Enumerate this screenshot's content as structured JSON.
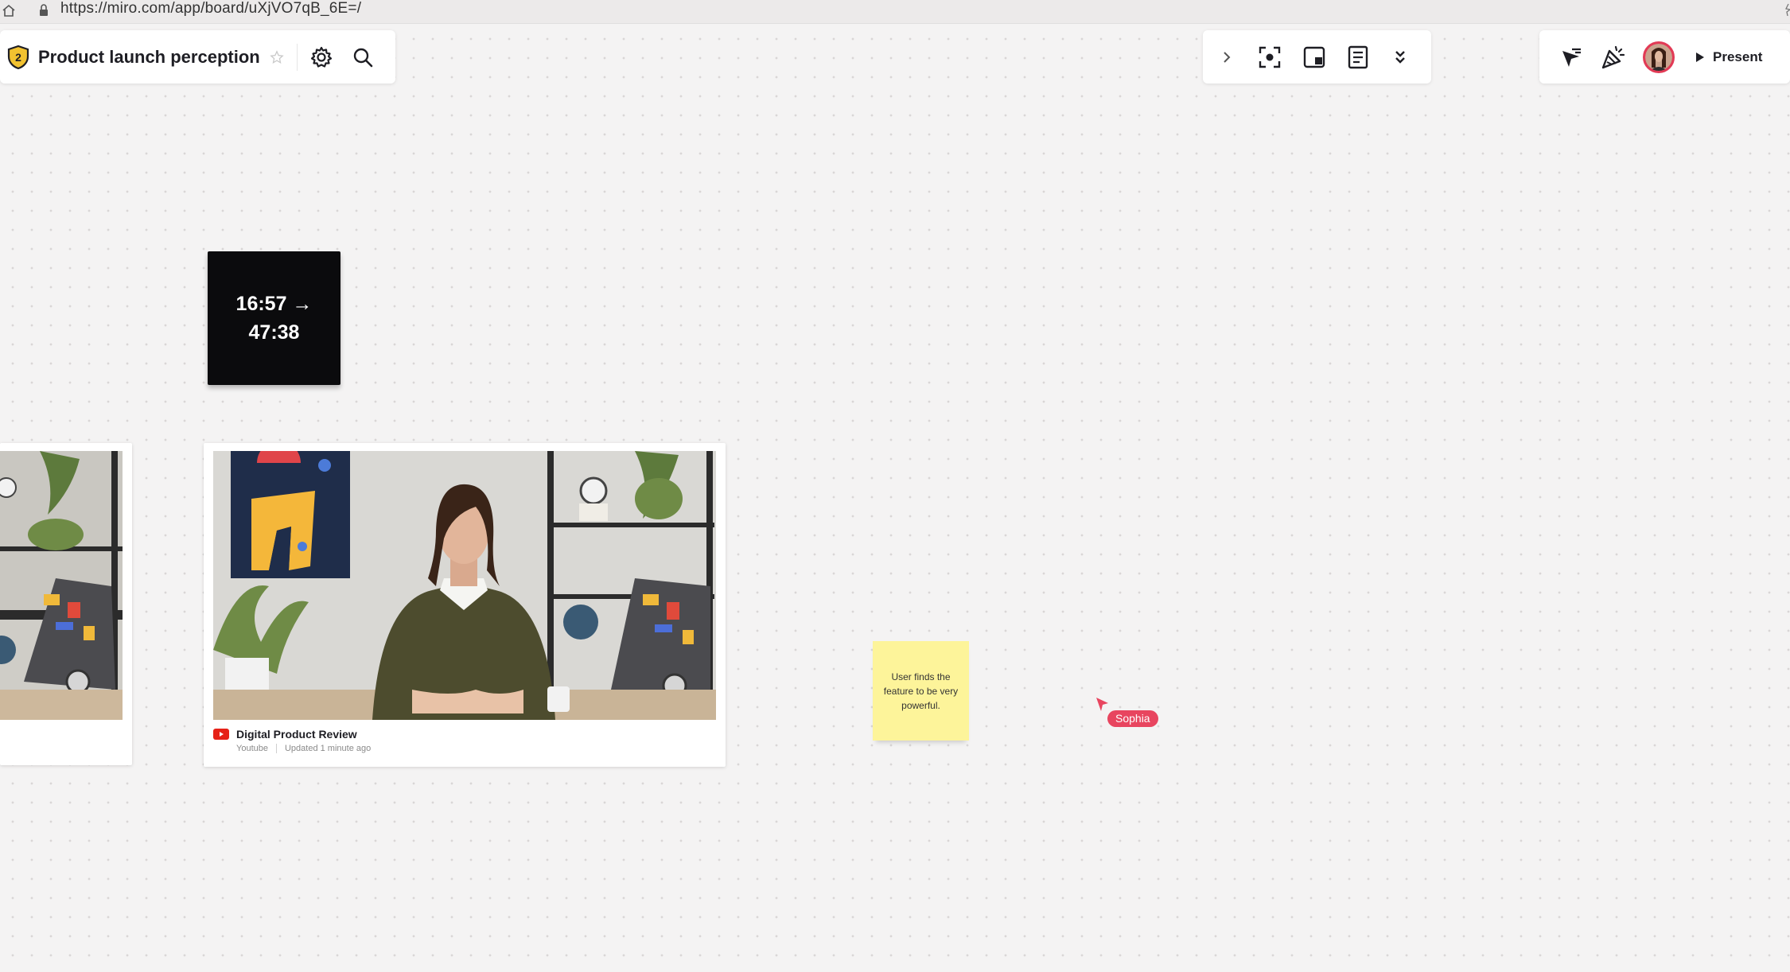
{
  "browser": {
    "url": "https://miro.com/app/board/uXjVO7qB_6E=/"
  },
  "board": {
    "title": "Product launch perception",
    "badge_number": "2"
  },
  "toolbar": {
    "present_label": "Present"
  },
  "canvas": {
    "timer": {
      "line1": "16:57 →",
      "line2": "47:38"
    },
    "video_card": {
      "title": "Digital Product Review",
      "source": "Youtube",
      "updated": "Updated 1 minute ago"
    },
    "sticky_note": {
      "text": "User finds the feature to be very powerful."
    },
    "collaborator_cursor": {
      "name": "Sophia"
    }
  },
  "colors": {
    "accent_pink": "#e8455f",
    "sticky_yellow": "#fdf49a",
    "timer_bg": "#0b0b0d",
    "youtube_red": "#e62117"
  }
}
